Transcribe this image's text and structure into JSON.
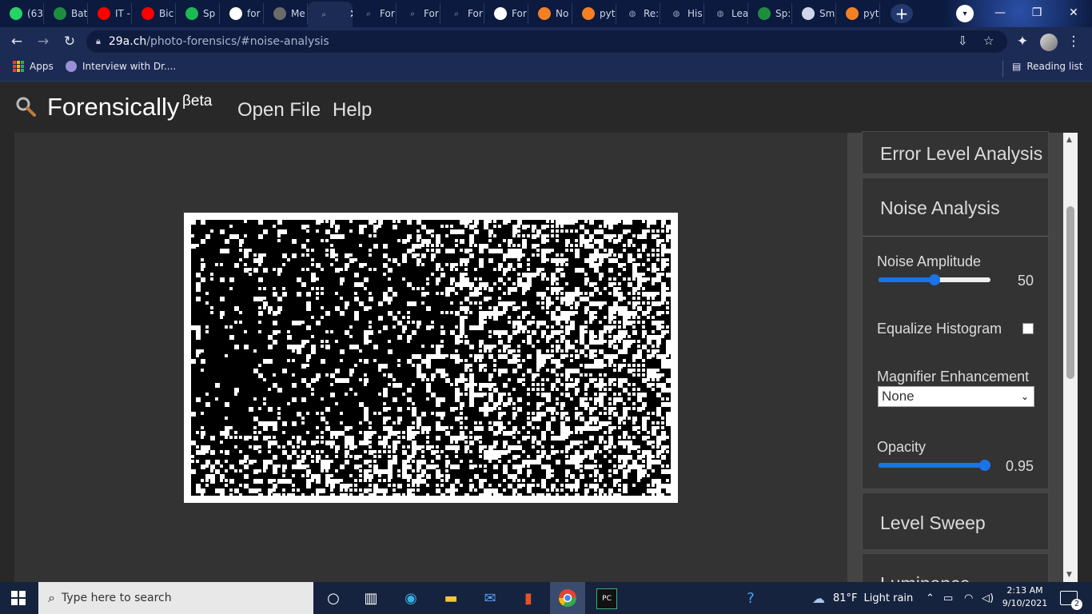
{
  "browser": {
    "tabs": [
      {
        "label": "(63",
        "icon": "whatsapp-icon",
        "color": "#25d366"
      },
      {
        "label": "Bat",
        "icon": "plus-app-icon",
        "color": "#1e8e3e"
      },
      {
        "label": "IT -",
        "icon": "youtube-icon",
        "color": "#ff0000"
      },
      {
        "label": "Bic",
        "icon": "youtube-icon",
        "color": "#ff0000"
      },
      {
        "label": "Sp",
        "icon": "spotify-icon",
        "color": "#1db954"
      },
      {
        "label": "for",
        "icon": "google-icon",
        "color": "#ffffff"
      },
      {
        "label": "Me",
        "icon": "page-icon",
        "color": "#6b6b6b"
      },
      {
        "label": "",
        "icon": "magnifier-icon",
        "color": "#9aa4c0",
        "active": true
      },
      {
        "label": "For",
        "icon": "magnifier-icon",
        "color": "#9aa4c0"
      },
      {
        "label": "For",
        "icon": "magnifier-icon",
        "color": "#9aa4c0"
      },
      {
        "label": "For",
        "icon": "magnifier-icon",
        "color": "#9aa4c0"
      },
      {
        "label": "For",
        "icon": "checker-icon",
        "color": "#ffffff"
      },
      {
        "label": "No",
        "icon": "stackoverflow-icon",
        "color": "#f48024"
      },
      {
        "label": "pyt",
        "icon": "stackoverflow-icon",
        "color": "#f48024"
      },
      {
        "label": "Re:",
        "icon": "globe-icon",
        "color": "#9aa4c0"
      },
      {
        "label": "His",
        "icon": "globe-icon",
        "color": "#9aa4c0"
      },
      {
        "label": "Lea",
        "icon": "globe-icon",
        "color": "#9aa4c0"
      },
      {
        "label": "Sp:",
        "icon": "link-icon",
        "color": "#1e8e3e"
      },
      {
        "label": "Sm",
        "icon": "book-icon",
        "color": "#cfd6ea"
      },
      {
        "label": "pyt",
        "icon": "stackoverflow-icon",
        "color": "#f48024"
      }
    ],
    "close_glyph": "✕",
    "new_tab_glyph": "+",
    "url_domain": "29a.ch",
    "url_path": "/photo-forensics/#noise-analysis",
    "bookmarks": {
      "apps_label": "Apps",
      "item_label": "Interview with Dr....",
      "reading_list_label": "Reading list"
    }
  },
  "app": {
    "brand": "Forensically",
    "beta": "βeta",
    "menu": [
      "Open File",
      "Help"
    ],
    "panels": {
      "ela_title": "Error Level Analysis",
      "noise_title": "Noise Analysis",
      "level_sweep_title": "Level Sweep",
      "next_title_partial": "Luminance"
    },
    "controls": {
      "noise_amplitude_label": "Noise Amplitude",
      "noise_amplitude_value": "50",
      "noise_amplitude_fraction": 0.5,
      "equalize_label": "Equalize Histogram",
      "equalize_checked": false,
      "magnifier_label": "Magnifier Enhancement",
      "magnifier_selected": "None",
      "opacity_label": "Opacity",
      "opacity_value": "0.95",
      "opacity_fraction": 0.95
    },
    "accent_color": "#1a73e8"
  },
  "taskbar": {
    "search_placeholder": "Type here to search",
    "weather_temp": "81°F",
    "weather_desc": "Light rain",
    "time": "2:13 AM",
    "date": "9/10/2021",
    "notification_count": "2"
  }
}
